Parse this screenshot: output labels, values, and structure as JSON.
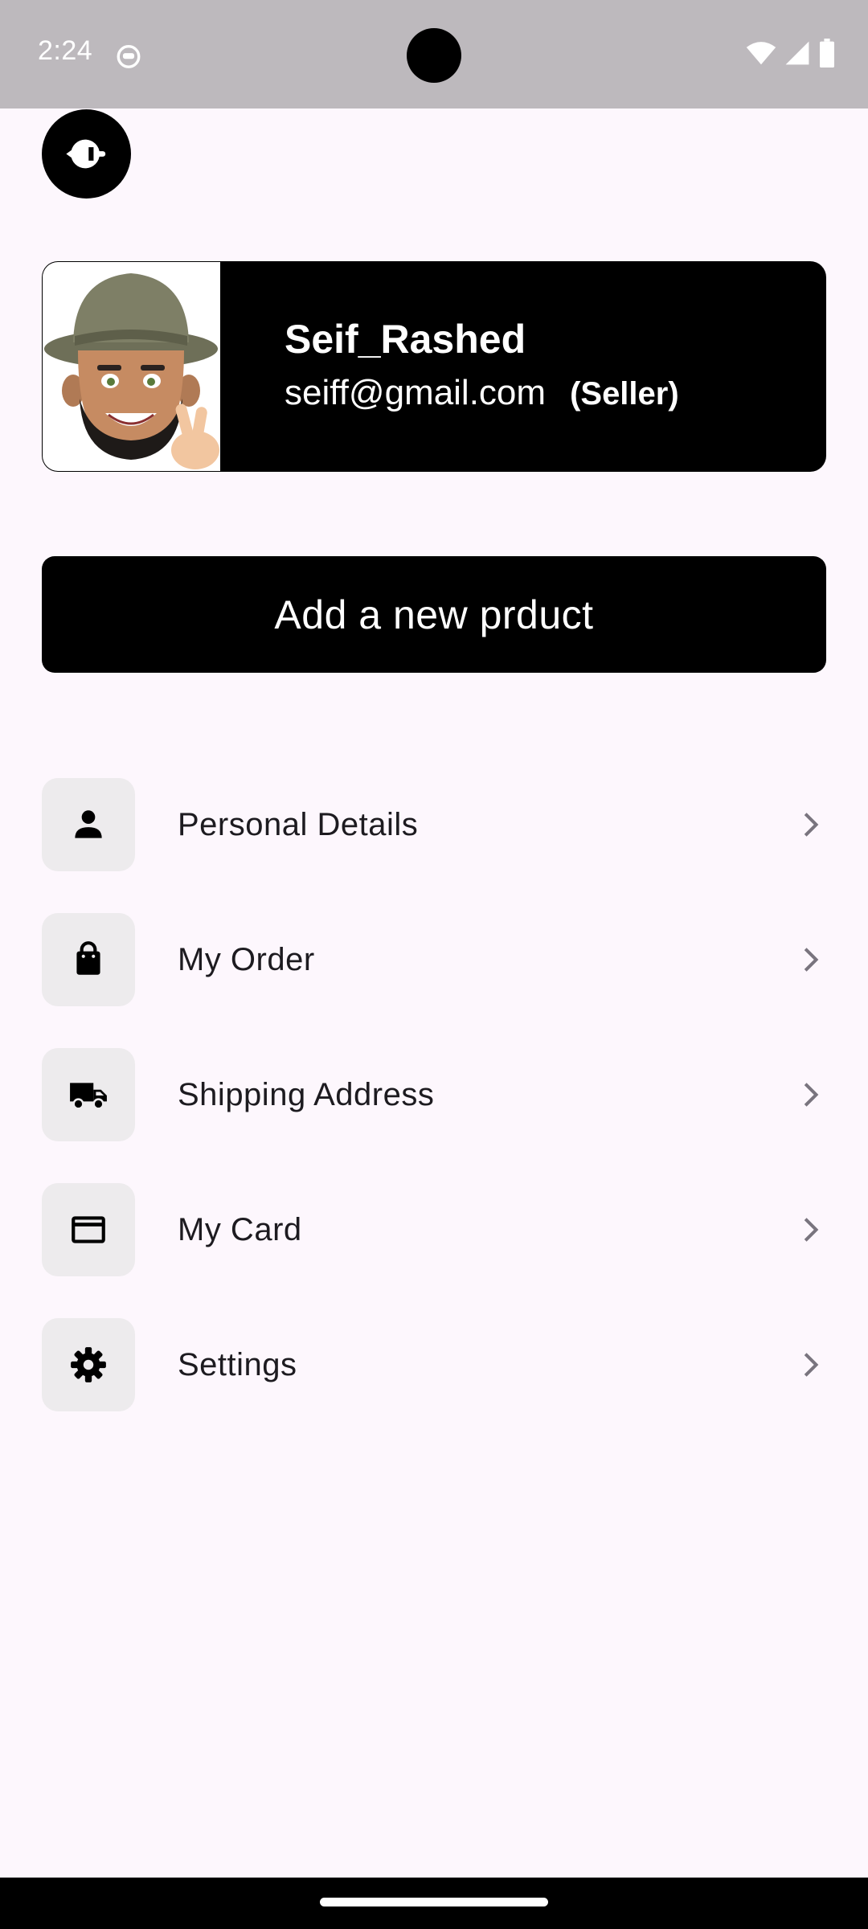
{
  "status_bar": {
    "time": "2:24",
    "notification_icon": "android-debug-icon",
    "wifi_icon": "wifi-icon",
    "signal_icon": "cell-signal-icon",
    "battery_icon": "battery-icon"
  },
  "header": {
    "back_icon": "back-arrow-icon"
  },
  "profile": {
    "name": "Seif_Rashed",
    "email": "seiff@gmail.com",
    "role": "(Seller)",
    "avatar_icon": "memoji-avatar"
  },
  "actions": {
    "add_product_label": "Add a new prduct"
  },
  "menu": {
    "items": [
      {
        "label": "Personal Details",
        "icon": "person-icon"
      },
      {
        "label": "My Order",
        "icon": "shopping-bag-icon"
      },
      {
        "label": "Shipping Address",
        "icon": "truck-icon"
      },
      {
        "label": "My Card",
        "icon": "credit-card-icon"
      },
      {
        "label": "Settings",
        "icon": "gear-icon"
      }
    ]
  },
  "colors": {
    "background": "#FDF7FD",
    "status_bar": "#BDB9BD",
    "primary": "#000000",
    "icon_box": "#EDEBED",
    "chevron": "#79747E"
  }
}
